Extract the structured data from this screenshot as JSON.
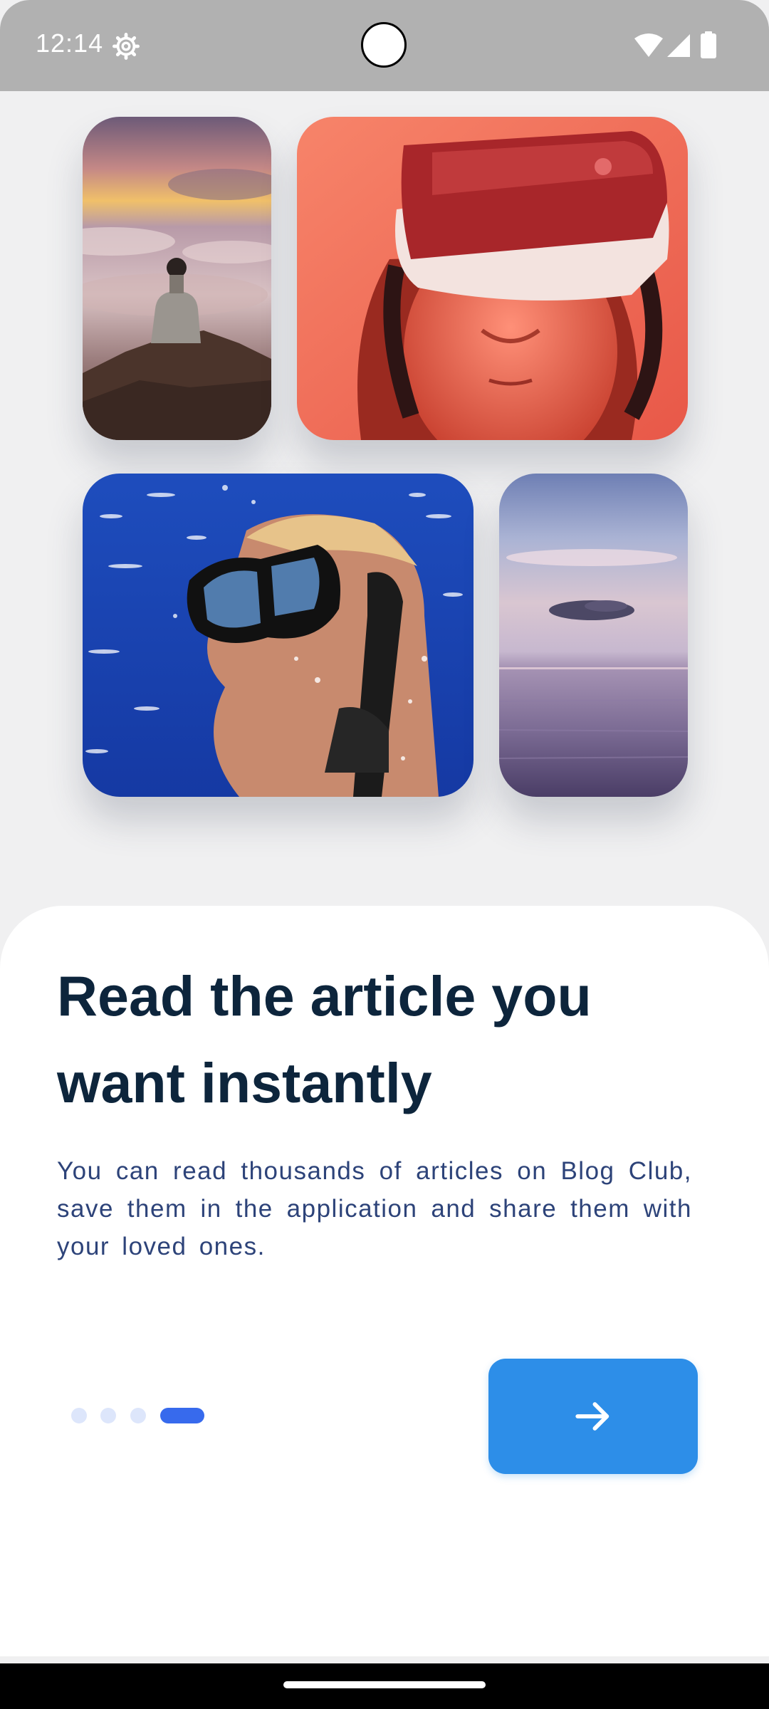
{
  "status_bar": {
    "time": "12:14",
    "icons": [
      "settings-gear-icon",
      "wifi-icon",
      "cell-signal-icon",
      "battery-icon"
    ]
  },
  "gallery": {
    "images": [
      "person-on-mountain-photo",
      "vr-headset-photo",
      "underwater-diver-photo",
      "ocean-horizon-photo"
    ]
  },
  "onboarding": {
    "title": "Read the article you want instantly",
    "description": "You can read thousands of articles on Blog Club, save them in the application and share them with your loved ones.",
    "page_indicator": {
      "total_pages": 4,
      "current_page": 4
    },
    "next_button": {
      "icon": "arrow-right-icon"
    }
  },
  "colors": {
    "background": "#f0f0f1",
    "title": "#0d253c",
    "body_text": "#2d4379",
    "accent": "#2d8ee8",
    "indicator_active": "#376aed",
    "indicator_inactive": "#dde6fb"
  }
}
